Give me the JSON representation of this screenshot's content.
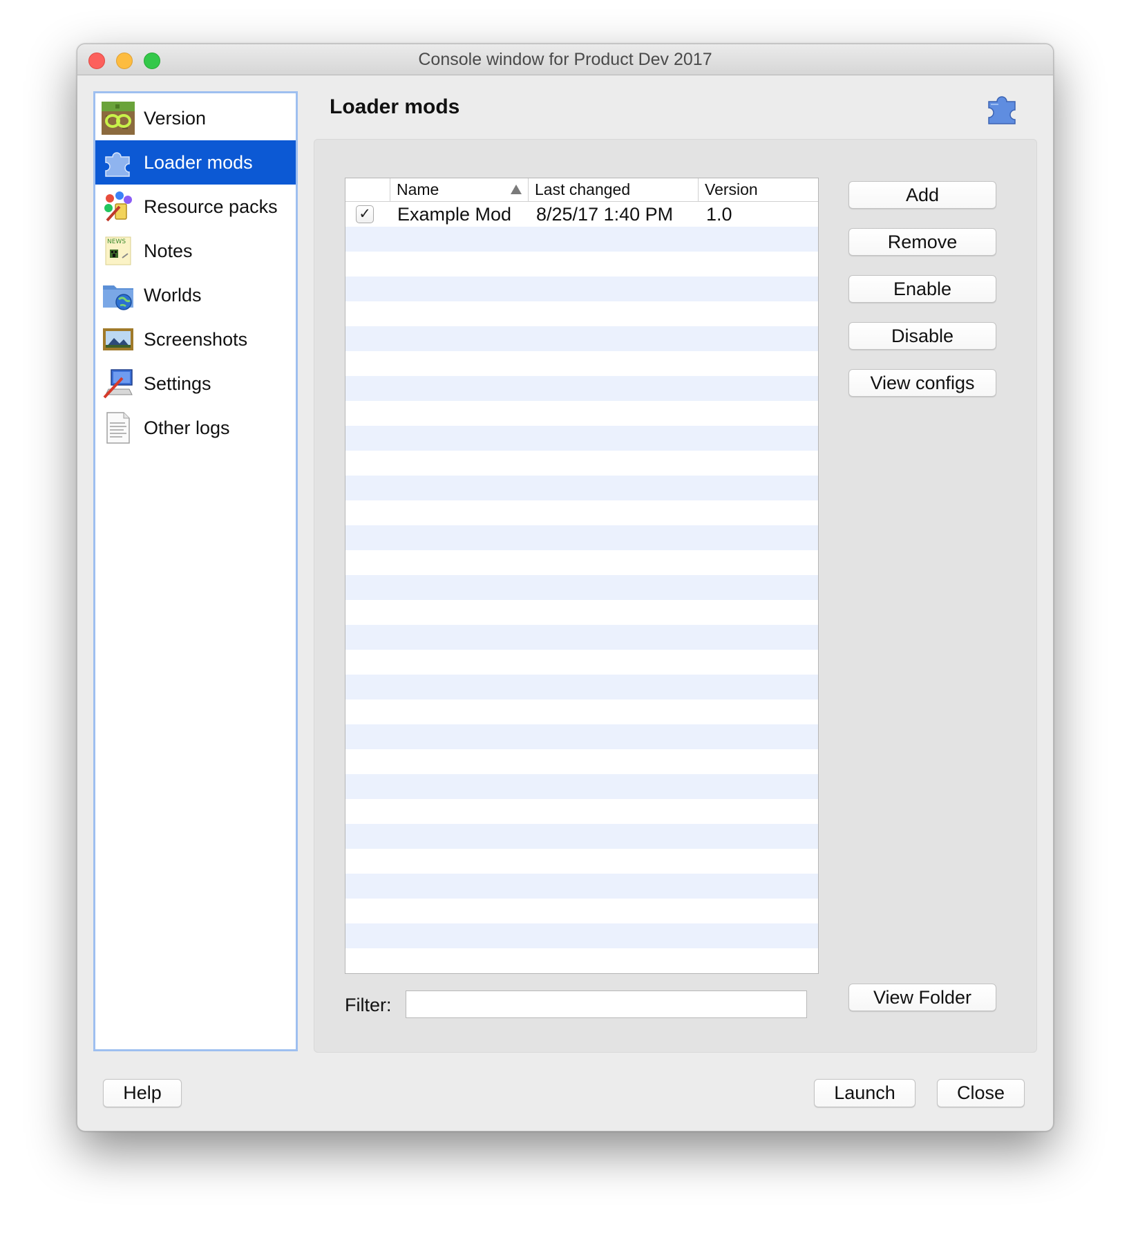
{
  "window": {
    "title": "Console window for Product Dev 2017"
  },
  "sidebar": {
    "items": [
      {
        "label": "Version",
        "icon": "version-icon"
      },
      {
        "label": "Loader mods",
        "icon": "puzzle-icon",
        "selected": true
      },
      {
        "label": "Resource packs",
        "icon": "paint-icon"
      },
      {
        "label": "Notes",
        "icon": "news-icon"
      },
      {
        "label": "Worlds",
        "icon": "world-folder-icon"
      },
      {
        "label": "Screenshots",
        "icon": "picture-icon"
      },
      {
        "label": "Settings",
        "icon": "settings-icon"
      },
      {
        "label": "Other logs",
        "icon": "log-file-icon"
      }
    ]
  },
  "main": {
    "heading": "Loader mods",
    "table": {
      "columns": [
        "Name",
        "Last changed",
        "Version"
      ],
      "sort_column": "Name",
      "rows": [
        {
          "enabled": true,
          "name": "Example Mod",
          "last_changed": "8/25/17 1:40 PM",
          "version": "1.0"
        }
      ]
    },
    "actions": [
      "Add",
      "Remove",
      "Enable",
      "Disable",
      "View configs"
    ],
    "view_folder_label": "View Folder",
    "filter": {
      "label": "Filter:",
      "value": "",
      "placeholder": ""
    }
  },
  "footer": {
    "help_label": "Help",
    "launch_label": "Launch",
    "close_label": "Close"
  },
  "colors": {
    "selection": "#0c59d4",
    "stripe": "#ebf1fd",
    "sidebar_border": "#9ebff0"
  }
}
